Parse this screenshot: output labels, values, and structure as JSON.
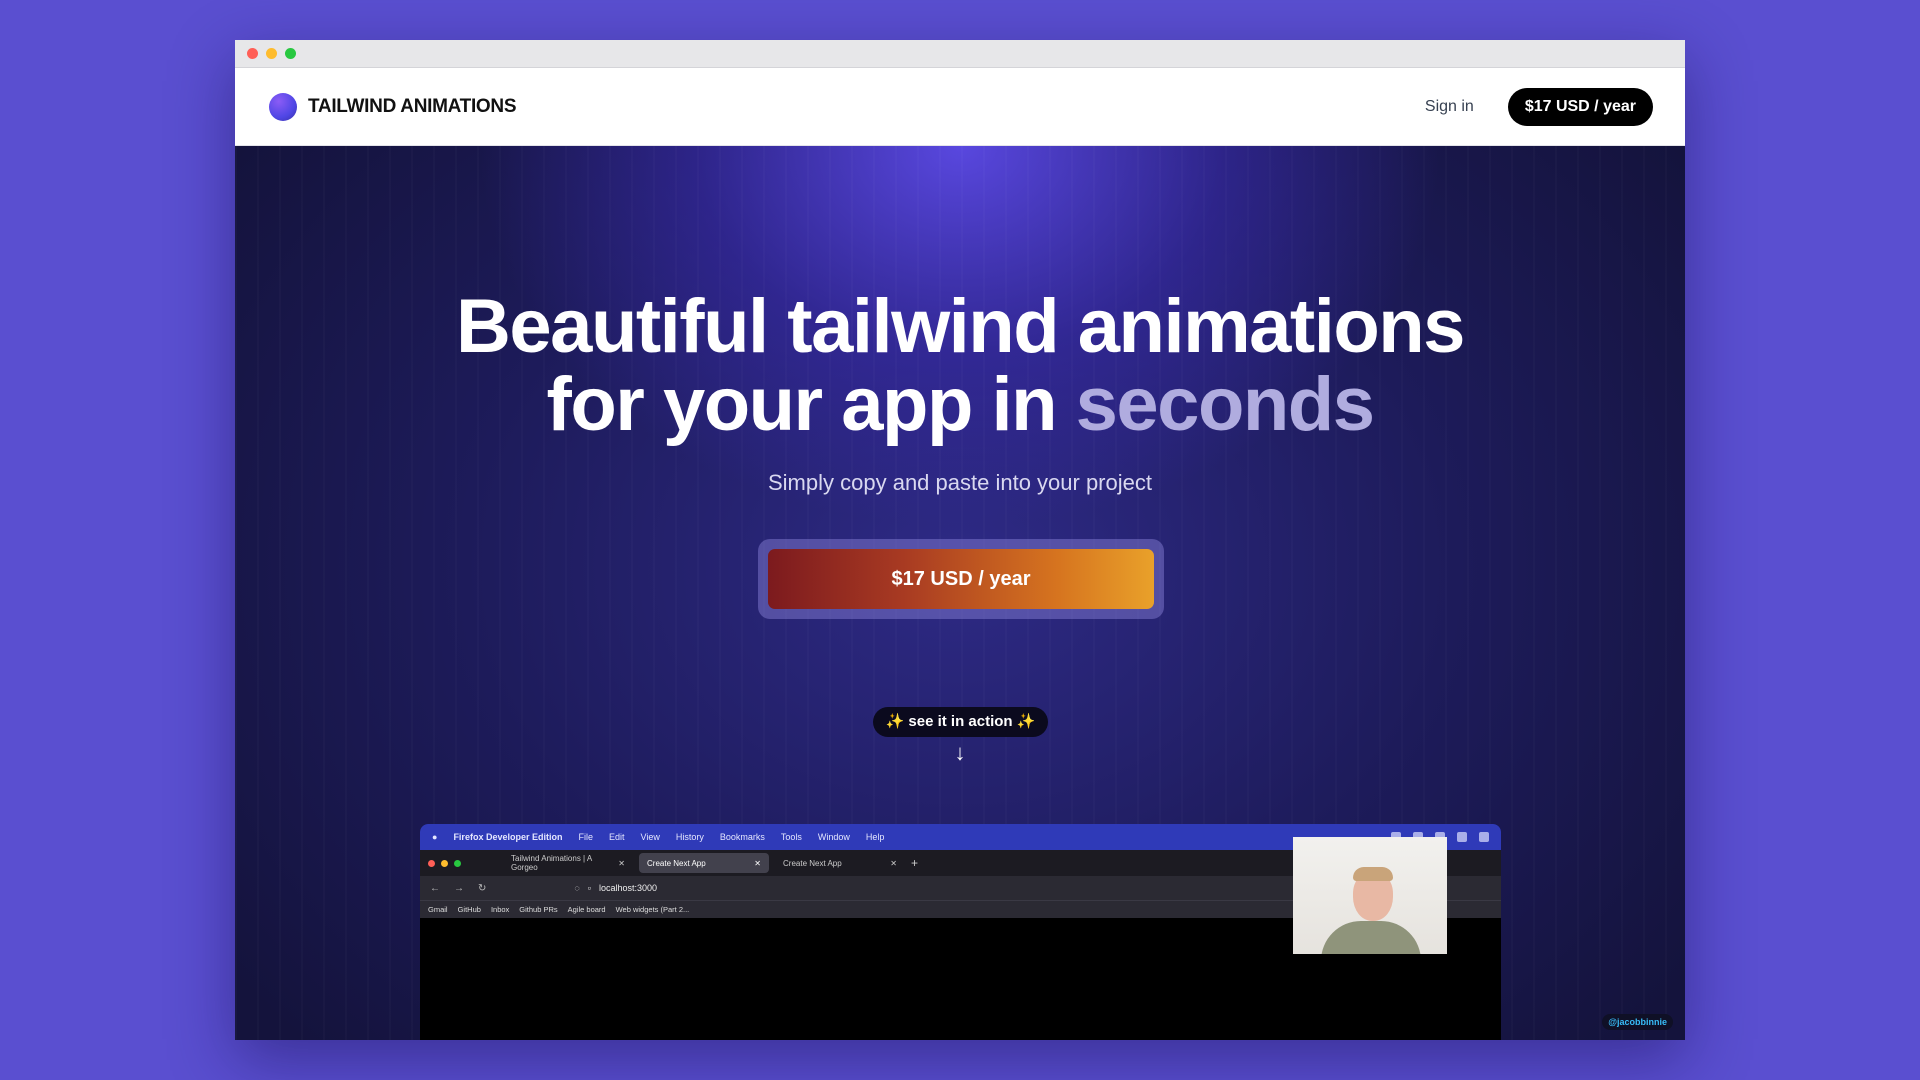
{
  "header": {
    "brand": "TAILWIND ANIMATIONS",
    "signin": "Sign in",
    "cta": "$17 USD / year"
  },
  "hero": {
    "headline_line1": "Beautiful tailwind animations",
    "headline_line2_prefix": "for your app in ",
    "headline_accent": "seconds",
    "subtitle": "Simply copy and paste into your project",
    "cta": "$17 USD / year",
    "see_action": "✨ see it in action ✨",
    "arrow": "↓"
  },
  "demo": {
    "menubar": {
      "app": "Firefox Developer Edition",
      "items": [
        "File",
        "Edit",
        "View",
        "History",
        "Bookmarks",
        "Tools",
        "Window",
        "Help"
      ]
    },
    "tabs": [
      {
        "label": "Tailwind Animations | A Gorgeo",
        "close": "✕"
      },
      {
        "label": "Create Next App",
        "close": "✕"
      },
      {
        "label": "Create Next App",
        "close": "✕"
      }
    ],
    "new_tab": "+",
    "url": "localhost:3000",
    "bookmarks": [
      "Gmail",
      "GitHub",
      "Inbox",
      "Github PRs",
      "Agile board",
      "Web widgets (Part 2..."
    ]
  },
  "watermark": "@jacobbinnie",
  "colors": {
    "background": "#5a4fd0",
    "accent": "#b0acdf",
    "cta_start": "#7c1a1e",
    "cta_end": "#e9a12a"
  }
}
